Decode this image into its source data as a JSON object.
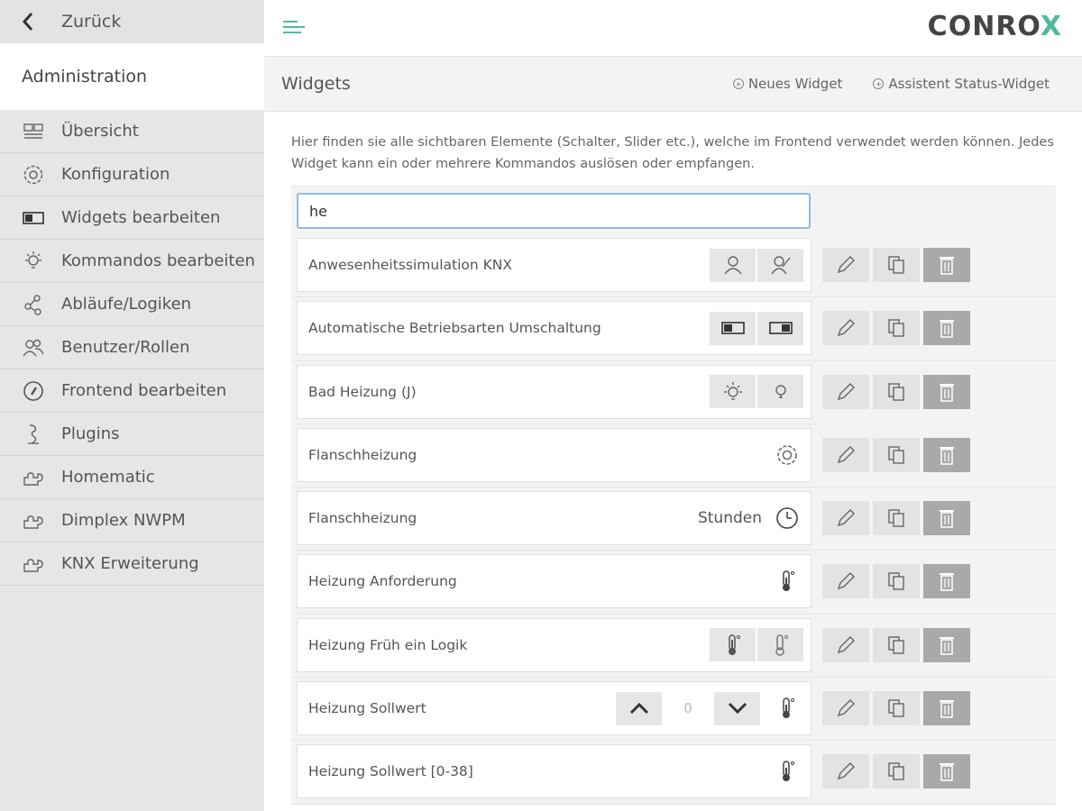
{
  "sidebar": {
    "back_label": "Zurück",
    "section_title": "Administration",
    "items": [
      {
        "label": "Übersicht",
        "icon": "overview-icon"
      },
      {
        "label": "Konfiguration",
        "icon": "gear-icon"
      },
      {
        "label": "Widgets bearbeiten",
        "icon": "widget-toggle-icon"
      },
      {
        "label": "Kommandos bearbeiten",
        "icon": "bulb-icon"
      },
      {
        "label": "Abläufe/Logiken",
        "icon": "share-nodes-icon"
      },
      {
        "label": "Benutzer/Rollen",
        "icon": "users-icon"
      },
      {
        "label": "Frontend bearbeiten",
        "icon": "compass-icon"
      },
      {
        "label": "Plugins",
        "icon": "plugin-icon"
      },
      {
        "label": "Homematic",
        "icon": "puzzle-icon"
      },
      {
        "label": "Dimplex NWPM",
        "icon": "puzzle-icon"
      },
      {
        "label": "KNX Erweiterung",
        "icon": "puzzle-icon"
      }
    ]
  },
  "header": {
    "logo_a": "CON",
    "logo_b": "RO",
    "logo_c": "X",
    "accent_color": "#4cba9f"
  },
  "page": {
    "title": "Widgets",
    "new_widget": "Neues Widget",
    "status_wizard": "Assistent Status-Widget",
    "description": "Hier finden sie alle sichtbaren Elemente (Schalter, Slider etc.), welche im Frontend verwendet werden können. Jedes Widget kann ein oder mehrere Kommandos auslösen oder empfangen."
  },
  "search": {
    "value": "he"
  },
  "widgets": [
    {
      "name": "Anwesenheitssimulation KNX"
    },
    {
      "name": "Automatische Betriebsarten Umschaltung"
    },
    {
      "name": "Bad Heizung (J)"
    },
    {
      "name": "Flanschheizung"
    },
    {
      "name": "Flanschheizung",
      "unit": "Stunden"
    },
    {
      "name": "Heizung Anforderung"
    },
    {
      "name": "Heizung Früh ein Logik"
    },
    {
      "name": "Heizung Sollwert",
      "value": "0"
    },
    {
      "name": "Heizung Sollwert [0-38]"
    }
  ]
}
